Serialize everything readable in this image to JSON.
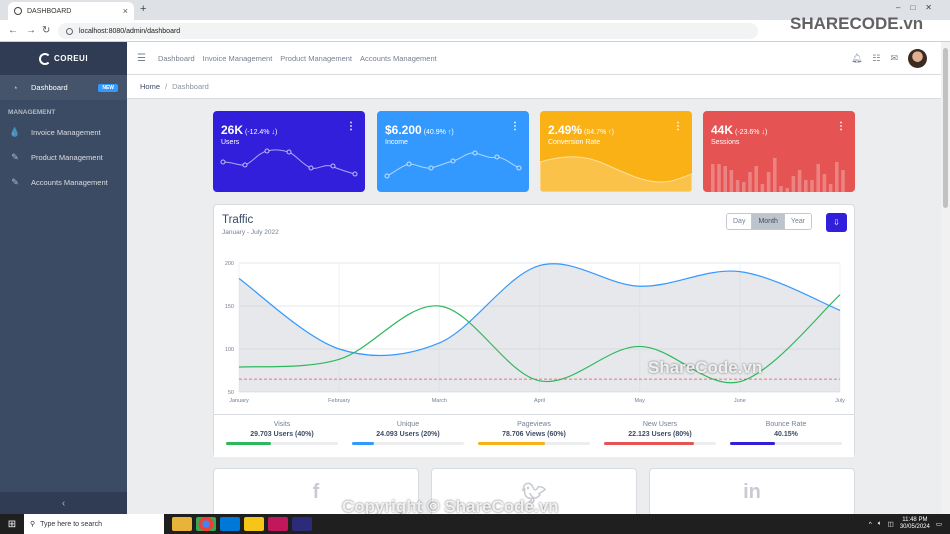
{
  "browser": {
    "tab_title": "DASHBOARD",
    "url": "localhost:8080/admin/dashboard"
  },
  "sidebar": {
    "brand": "COREUI",
    "items": [
      {
        "label": "Dashboard",
        "icon": "speedometer-icon",
        "badge": "NEW"
      },
      {
        "label": "Invoice Management",
        "icon": "drop-icon"
      },
      {
        "label": "Product Management",
        "icon": "pencil-icon"
      },
      {
        "label": "Accounts Management",
        "icon": "pencil-icon"
      }
    ],
    "section_title": "MANAGEMENT"
  },
  "header": {
    "nav": [
      "Dashboard",
      "Invoice Management",
      "Product Management",
      "Accounts Management"
    ]
  },
  "breadcrumb": {
    "home": "Home",
    "current": "Dashboard"
  },
  "widgets": [
    {
      "value": "26K",
      "change": "(-12.4% ↓)",
      "label": "Users",
      "color": "#321fdb"
    },
    {
      "value": "$6.200",
      "change": "(40.9% ↑)",
      "label": "Income",
      "color": "#39f"
    },
    {
      "value": "2.49%",
      "change": "(84.7% ↑)",
      "label": "Conversion Rate",
      "color": "#f9b115"
    },
    {
      "value": "44K",
      "change": "(-23.6% ↓)",
      "label": "Sessions",
      "color": "#e55353"
    }
  ],
  "traffic": {
    "title": "Traffic",
    "subtitle": "January - July 2022",
    "ranges": [
      "Day",
      "Month",
      "Year"
    ],
    "active_range": "Month",
    "stats": [
      {
        "label": "Visits",
        "value": "29.703 Users (40%)",
        "percent": 40,
        "color": "#2eb85c"
      },
      {
        "label": "Unique",
        "value": "24.093 Users (20%)",
        "percent": 20,
        "color": "#39f"
      },
      {
        "label": "Pageviews",
        "value": "78.706 Views (60%)",
        "percent": 60,
        "color": "#f9b115"
      },
      {
        "label": "New Users",
        "value": "22.123 Users (80%)",
        "percent": 80,
        "color": "#e55353"
      },
      {
        "label": "Bounce Rate",
        "value": "40.15%",
        "percent": 40,
        "color": "#321fdb"
      }
    ]
  },
  "chart_data": {
    "type": "line",
    "categories": [
      "January",
      "February",
      "March",
      "April",
      "May",
      "June",
      "July"
    ],
    "yticks": [
      50,
      100,
      150,
      200
    ],
    "ylim": [
      50,
      200
    ],
    "series": [
      {
        "values": [
          182,
          100,
          107,
          197,
          173,
          190,
          145
        ],
        "color": "#39f",
        "fill": true
      },
      {
        "values": [
          79,
          88,
          150,
          63,
          103,
          62,
          163
        ],
        "color": "#2eb85c"
      },
      {
        "values": [
          65,
          65,
          65,
          65,
          65,
          65,
          65
        ],
        "color": "#e55353",
        "dashed": true
      }
    ],
    "grid": true
  },
  "taskbar": {
    "search_placeholder": "Type here to search",
    "time": "11:48 PM",
    "date": "30/05/2024"
  },
  "watermarks": {
    "logo": "SHARECODE.vn",
    "chart": "ShareCode.vn",
    "footer": "Copyright © ShareCode.vn"
  }
}
